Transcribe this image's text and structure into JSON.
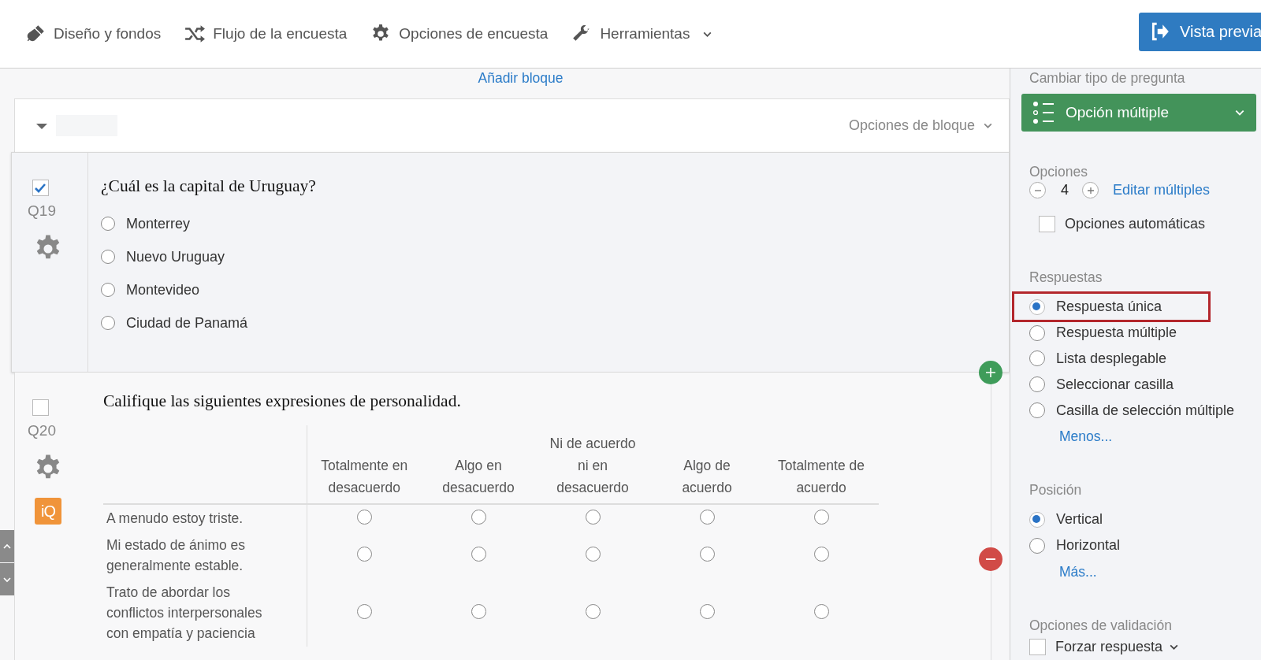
{
  "toolbar": {
    "items": [
      {
        "label": "Diseño y fondos",
        "dropdown": false
      },
      {
        "label": "Flujo de la encuesta",
        "dropdown": false
      },
      {
        "label": "Opciones de encuesta",
        "dropdown": false
      },
      {
        "label": "Herramientas",
        "dropdown": true
      }
    ],
    "preview_button": "Vista previa"
  },
  "add_block_link": "Añadir bloque",
  "block": {
    "expanded": true,
    "options_label": "Opciones de bloque"
  },
  "questions": [
    {
      "kind": "multiple_choice",
      "number": "Q19",
      "checked": true,
      "text": "¿Cuál es la capital de Uruguay?",
      "choices": [
        {
          "label": "Monterrey",
          "selected": false
        },
        {
          "label": "Nuevo Uruguay",
          "selected": false
        },
        {
          "label": "Montevideo",
          "selected": false
        },
        {
          "label": "Ciudad de Panamá",
          "selected": false
        }
      ]
    },
    {
      "kind": "matrix",
      "number": "Q20",
      "checked": false,
      "badge": "iQ",
      "text": "Califique las siguientes expresiones de personalidad.",
      "columns": [
        "Totalmente en desacuerdo",
        "Algo en desacuerdo",
        "Ni de acuerdo ni en desacuerdo",
        "Algo de acuerdo",
        "Totalmente de acuerdo"
      ],
      "rows": [
        {
          "label": "A menudo estoy triste.",
          "cells": [
            {
              "selected": false
            },
            {
              "selected": false
            },
            {
              "selected": false
            },
            {
              "selected": false
            },
            {
              "selected": false
            }
          ]
        },
        {
          "label": "Mi estado de ánimo es generalmente estable.",
          "cells": [
            {
              "selected": false
            },
            {
              "selected": false
            },
            {
              "selected": false
            },
            {
              "selected": false
            },
            {
              "selected": false
            }
          ]
        },
        {
          "label": "Trato de abordar los conflictos interpersonales con empatía y paciencia",
          "cells": [
            {
              "selected": false
            },
            {
              "selected": false
            },
            {
              "selected": false
            },
            {
              "selected": false
            },
            {
              "selected": false
            }
          ]
        }
      ]
    }
  ],
  "panel": {
    "question_type": {
      "label": "Cambiar tipo de pregunta",
      "value": "Opción múltiple"
    },
    "choices": {
      "label": "Opciones",
      "count": "4",
      "edit_link": "Editar múltiples",
      "auto": {
        "label": "Opciones automáticas",
        "checked": false
      }
    },
    "answers": {
      "label": "Respuestas",
      "options": [
        {
          "label": "Respuesta única",
          "selected": true,
          "highlighted": true
        },
        {
          "label": "Respuesta múltiple",
          "selected": false,
          "highlighted": false
        },
        {
          "label": "Lista desplegable",
          "selected": false,
          "highlighted": false
        },
        {
          "label": "Seleccionar casilla",
          "selected": false,
          "highlighted": false
        },
        {
          "label": "Casilla de selección múltiple",
          "selected": false,
          "highlighted": false
        }
      ],
      "link": "Menos..."
    },
    "position": {
      "label": "Posición",
      "options": [
        {
          "label": "Vertical",
          "selected": true
        },
        {
          "label": "Horizontal",
          "selected": false
        }
      ],
      "link": "Más..."
    },
    "validation": {
      "label": "Opciones de validación",
      "force": {
        "label": "Forzar respuesta",
        "checked": false
      }
    }
  }
}
